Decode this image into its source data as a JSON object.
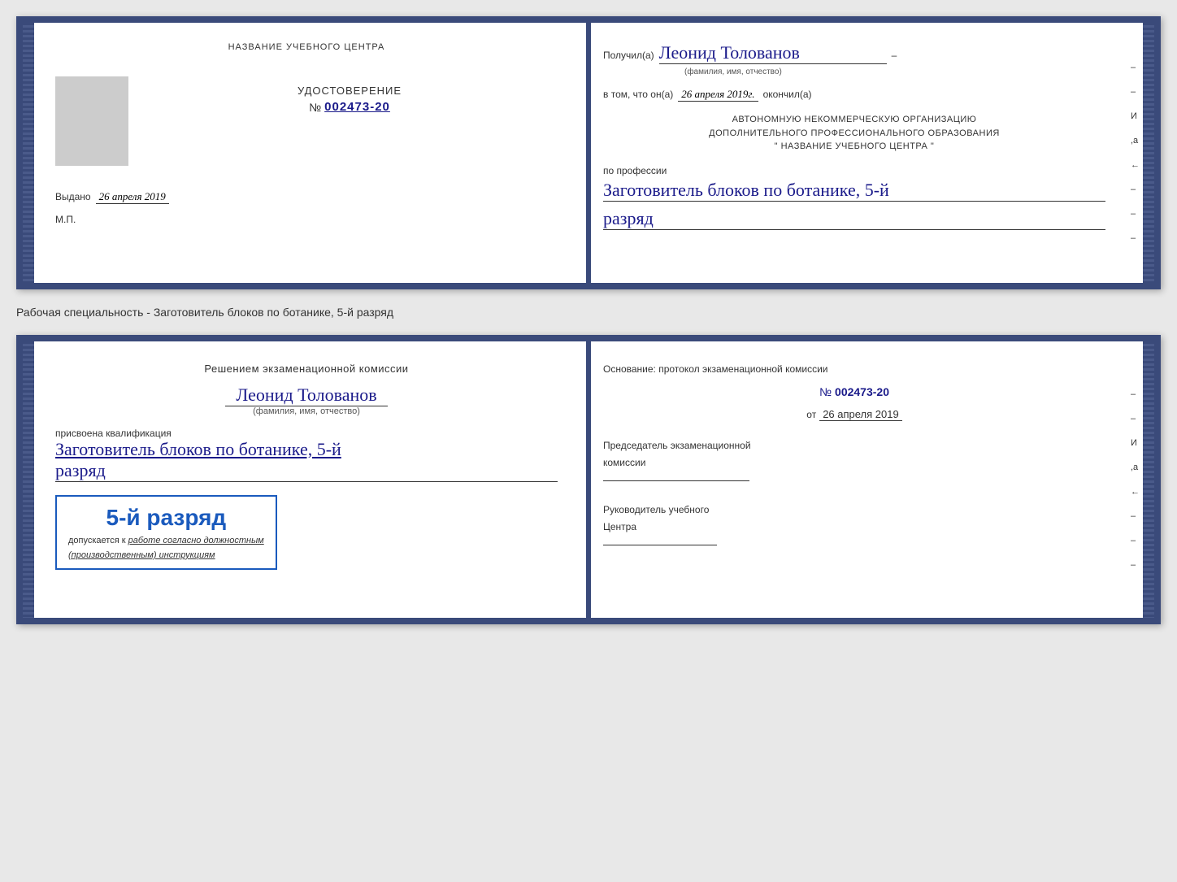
{
  "page": {
    "background": "#e8e8e8"
  },
  "doc1": {
    "left": {
      "center_title": "НАЗВАНИЕ УЧЕБНОГО ЦЕНТРА",
      "cert_label": "УДОСТОВЕРЕНИЕ",
      "cert_number_prefix": "№",
      "cert_number": "002473-20",
      "issued_label": "Выдано",
      "issued_date": "26 апреля 2019",
      "mp_label": "М.П."
    },
    "right": {
      "received_prefix": "Получил(а)",
      "recipient_name": "Леонид Толованов",
      "sub_fio": "(фамилия, имя, отчество)",
      "cert_text1": "в том, что он(а)",
      "date_value": "26 апреля 2019г.",
      "finished": "окончил(а)",
      "org_line1": "АВТОНОМНУЮ НЕКОММЕРЧЕСКУЮ ОРГАНИЗАЦИЮ",
      "org_line2": "ДОПОЛНИТЕЛЬНОГО ПРОФЕССИОНАЛЬНОГО ОБРАЗОВАНИЯ",
      "org_line3": "\"   НАЗВАНИЕ УЧЕБНОГО ЦЕНТРА   \"",
      "profession_label": "по профессии",
      "profession_value": "Заготовитель блоков по ботанике, 5-й",
      "razryad_value": "разряд",
      "side_i": "И",
      "side_a": ",а",
      "side_arrow": "←"
    }
  },
  "separator": {
    "text": "Рабочая специальность - Заготовитель блоков по ботанике, 5-й разряд"
  },
  "doc2": {
    "left": {
      "decision_text": "Решением экзаменационной комиссии",
      "person_name": "Леонид Толованов",
      "sub_fio": "(фамилия, имя, отчество)",
      "assigned_text": "присвоена квалификация",
      "qual_value": "Заготовитель блоков по ботанике, 5-й",
      "razryad_value": "разряд",
      "stamp_grade": "5-й разряд",
      "stamp_admit": "допускается к",
      "stamp_work": "работе согласно должностным",
      "stamp_instr": "(производственным) инструкциям"
    },
    "right": {
      "basis_text": "Основание: протокол экзаменационной комиссии",
      "number_prefix": "№",
      "number_value": "002473-20",
      "date_prefix": "от",
      "date_value": "26 апреля 2019",
      "chair_title": "Председатель экзаменационной",
      "chair_title2": "комиссии",
      "head_title": "Руководитель учебного",
      "head_title2": "Центра",
      "side_i": "И",
      "side_a": ",а",
      "side_arrow": "←"
    }
  }
}
